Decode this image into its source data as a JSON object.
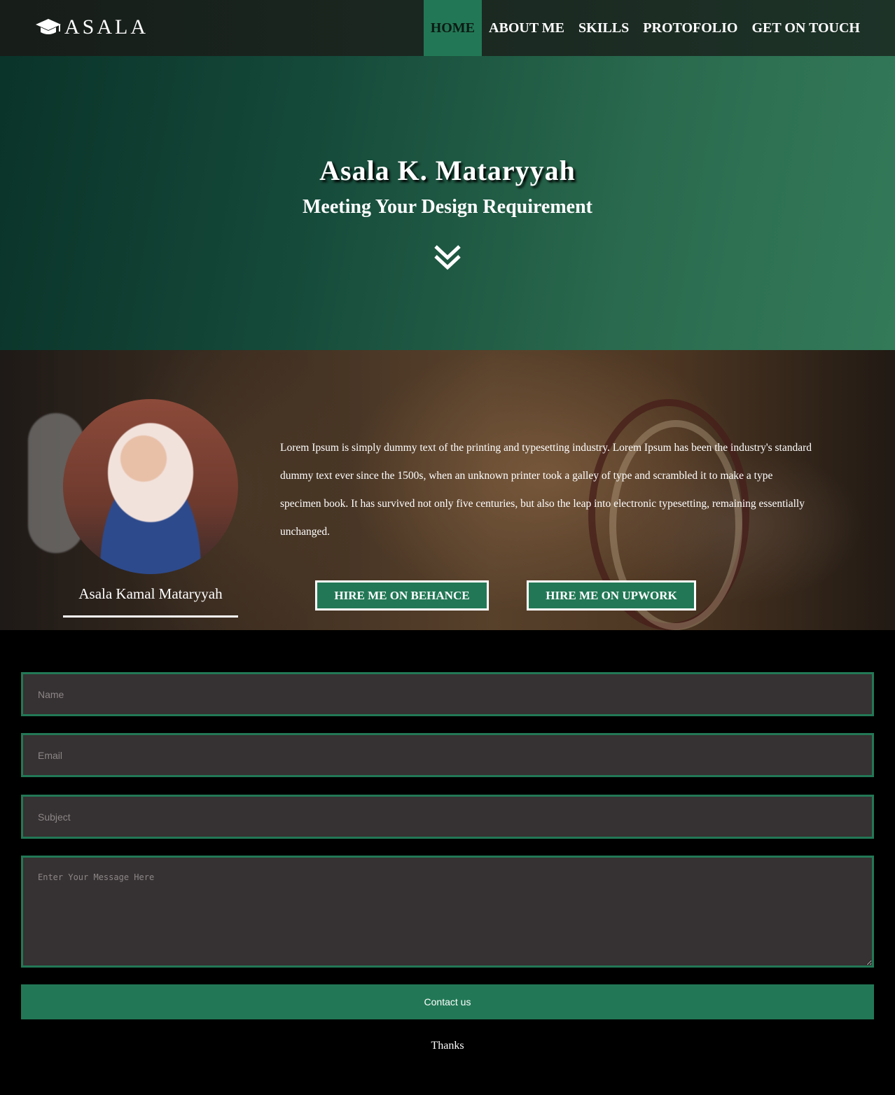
{
  "navbar": {
    "brand": "ASALA",
    "brand_icon": "graduation-cap-icon",
    "items": [
      {
        "label": "HOME",
        "active": true
      },
      {
        "label": "ABOUT ME"
      },
      {
        "label": "SKILLS"
      },
      {
        "label": "PROTOFOLIO"
      },
      {
        "label": "GET ON TOUCH"
      }
    ]
  },
  "hero": {
    "title": "Asala K. Mataryyah",
    "subtitle": "Meeting Your Design Requirement",
    "scroll_icon": "double-chevron-down-icon"
  },
  "about": {
    "name": "Asala Kamal Mataryyah",
    "text": "Lorem Ipsum is simply dummy text of the printing and typesetting industry. Lorem Ipsum has been the industry's standard dummy text ever since the 1500s, when an unknown printer took a galley of type and scrambled it to make a type specimen book. It has survived not only five centuries, but also the leap into electronic typesetting, remaining essentially unchanged.",
    "behance_label": "HIRE ME ON BEHANCE",
    "upwork_label": "HIRE ME ON UPWORK"
  },
  "form": {
    "name_placeholder": "Name",
    "email_placeholder": "Email",
    "subject_placeholder": "Subject",
    "message_placeholder": "Enter Your Message Here",
    "submit_label": "Contact us",
    "thanks": "Thanks"
  },
  "colors": {
    "accent": "#227856",
    "field_bg": "#363132"
  }
}
